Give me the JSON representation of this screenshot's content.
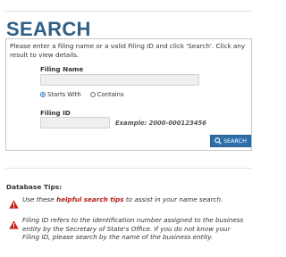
{
  "page": {
    "title": "SEARCH",
    "intro": "Please enter a filing name or a valid Filing ID and click 'Search'. Click any result to view details."
  },
  "form": {
    "filing_name_label": "Filing Name",
    "filing_name_value": "",
    "radio_options": [
      {
        "label": "Starts With",
        "selected": true
      },
      {
        "label": "Contains",
        "selected": false
      }
    ],
    "filing_id_label": "Filing ID",
    "filing_id_value": "",
    "example_text": "Example: 2000-000123456",
    "search_button": "SEARCH"
  },
  "tips": {
    "heading": "Database Tips:",
    "items": [
      {
        "pre": "Use these ",
        "highlight": "helpful search tips",
        "post": " to assist in your name search."
      },
      {
        "pre": "Filing ID refers to the identification number assigned to the business entity by the Secretary of State's Office. If you do not know your Filing ID, please search by the name of the business entity.",
        "highlight": "",
        "post": ""
      }
    ]
  },
  "colors": {
    "title": "#2f5f86",
    "button": "#2f6fa8",
    "warning": "#c0281f",
    "link": "#b0201c"
  }
}
